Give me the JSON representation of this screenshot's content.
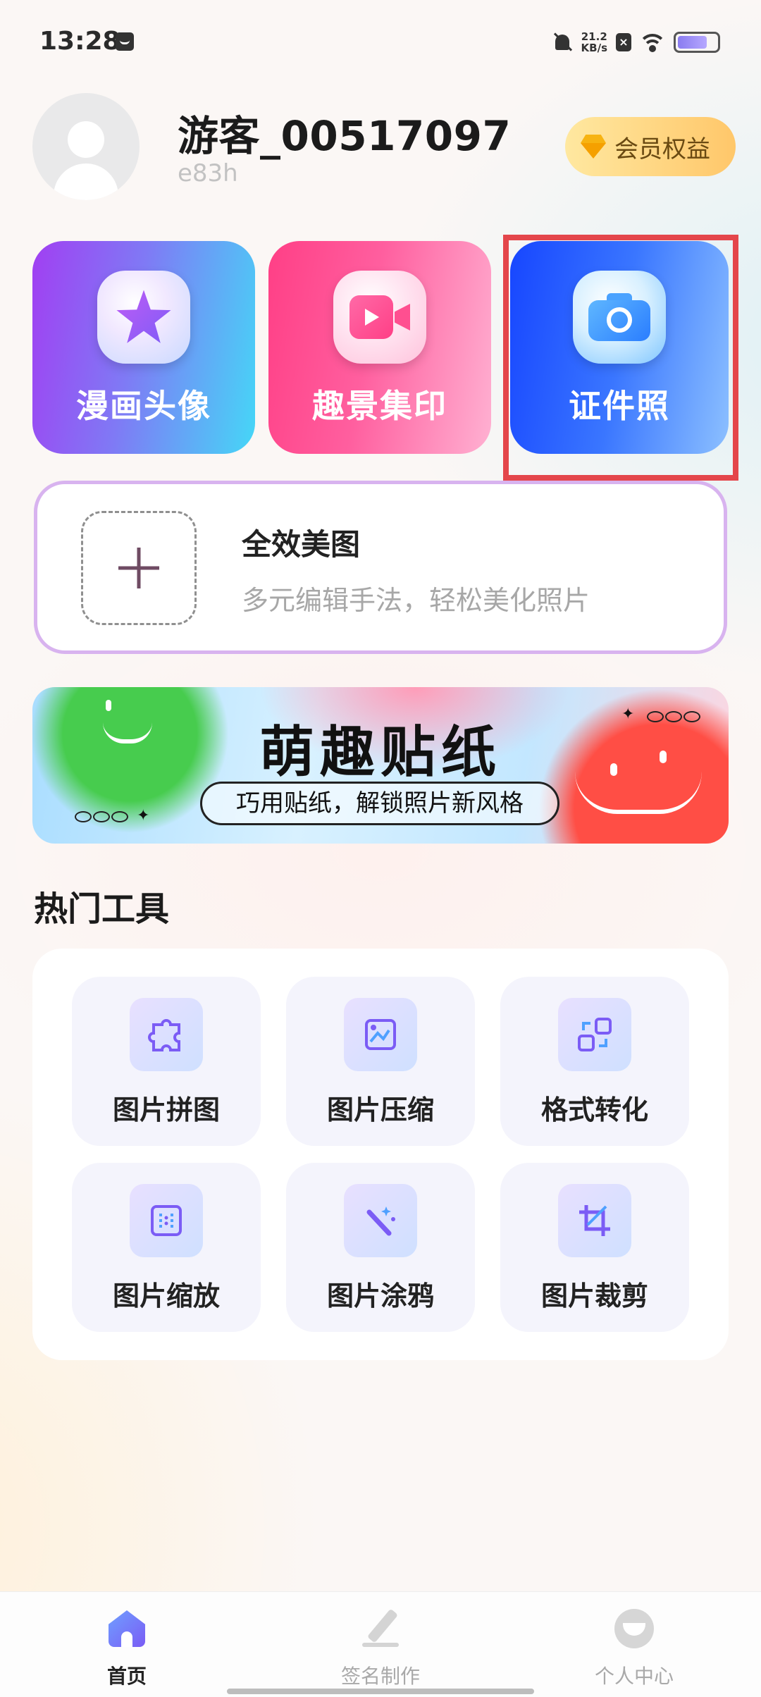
{
  "status_bar": {
    "time": "13:28",
    "net_speed_value": "21.2",
    "net_speed_unit": "KB/s",
    "battery_level": 0.75
  },
  "profile": {
    "name": "游客_00517097",
    "sub": "e83h",
    "vip_label": "会员权益"
  },
  "features": [
    {
      "label": "漫画头像",
      "icon": "star-icon"
    },
    {
      "label": "趣景集印",
      "icon": "video-camera-icon"
    },
    {
      "label": "证件照",
      "icon": "camera-icon"
    }
  ],
  "beautify": {
    "title": "全效美图",
    "subtitle": "多元编辑手法，轻松美化照片"
  },
  "sticker_banner": {
    "title": "萌趣贴纸",
    "subtitle": "巧用贴纸，解锁照片新风格"
  },
  "hot_tools": {
    "title": "热门工具",
    "items": [
      {
        "label": "图片拼图",
        "icon": "puzzle-icon"
      },
      {
        "label": "图片压缩",
        "icon": "image-compress-icon"
      },
      {
        "label": "格式转化",
        "icon": "format-convert-icon"
      },
      {
        "label": "图片缩放",
        "icon": "resize-icon"
      },
      {
        "label": "图片涂鸦",
        "icon": "magic-wand-icon"
      },
      {
        "label": "图片裁剪",
        "icon": "crop-icon"
      }
    ]
  },
  "bottom_nav": {
    "items": [
      {
        "label": "首页",
        "icon": "home-icon",
        "active": true
      },
      {
        "label": "签名制作",
        "icon": "pen-icon",
        "active": false
      },
      {
        "label": "个人中心",
        "icon": "profile-icon",
        "active": false
      }
    ]
  },
  "colors": {
    "highlight": "#e4464b",
    "accent_purple": "#7a5cf5",
    "beautify_border": "#d8b3ef"
  }
}
